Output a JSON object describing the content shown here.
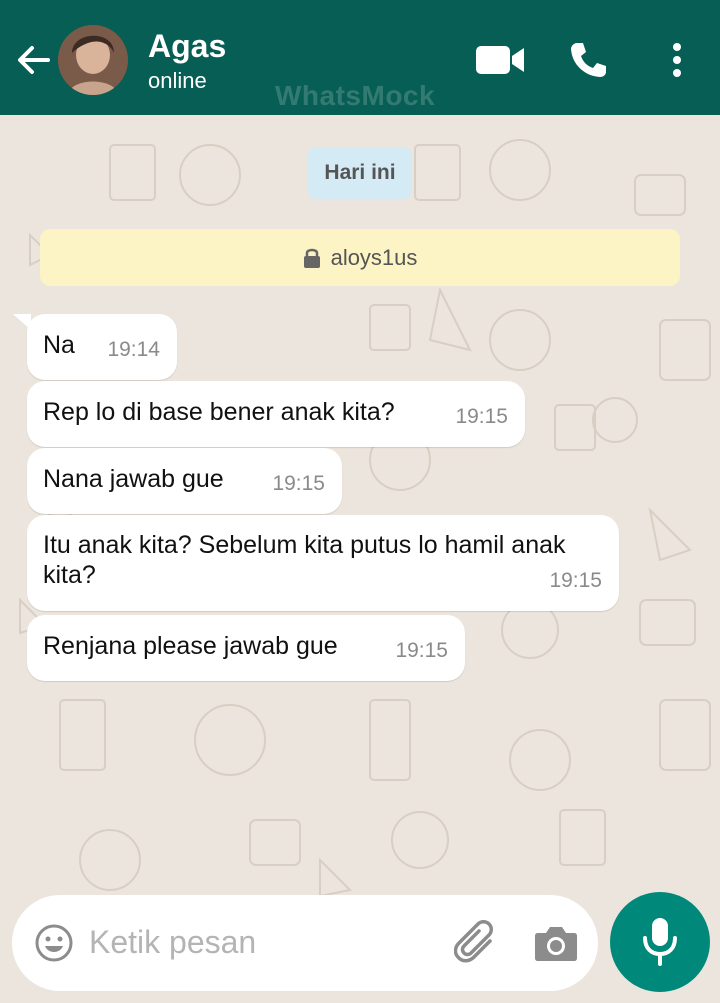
{
  "header": {
    "contact_name": "Agas",
    "contact_status": "online",
    "watermark": "WhatsMock",
    "icons": [
      "back-arrow-icon",
      "video-call-icon",
      "phone-call-icon",
      "more-options-icon"
    ]
  },
  "chat": {
    "date_chip": "Hari ini",
    "encryption_notice": "aloys1us",
    "messages": [
      {
        "text": "Na",
        "time": "19:14"
      },
      {
        "text": "Rep lo di base bener anak kita?",
        "time": "19:15"
      },
      {
        "text": "Nana jawab gue",
        "time": "19:15"
      },
      {
        "text": "Itu anak kita? Sebelum kita putus lo hamil anak kita?",
        "time": "19:15"
      },
      {
        "text": "Renjana please jawab gue",
        "time": "19:15"
      }
    ]
  },
  "input": {
    "placeholder": "Ketik pesan",
    "icons": [
      "emoji-icon",
      "attach-icon",
      "camera-icon",
      "mic-icon"
    ]
  },
  "colors": {
    "header_bg": "#075e54",
    "chat_bg": "#ece5dd",
    "mic_button": "#00897b",
    "date_chip_bg": "#d4eaf4",
    "notice_bg": "#fcf4c4"
  }
}
